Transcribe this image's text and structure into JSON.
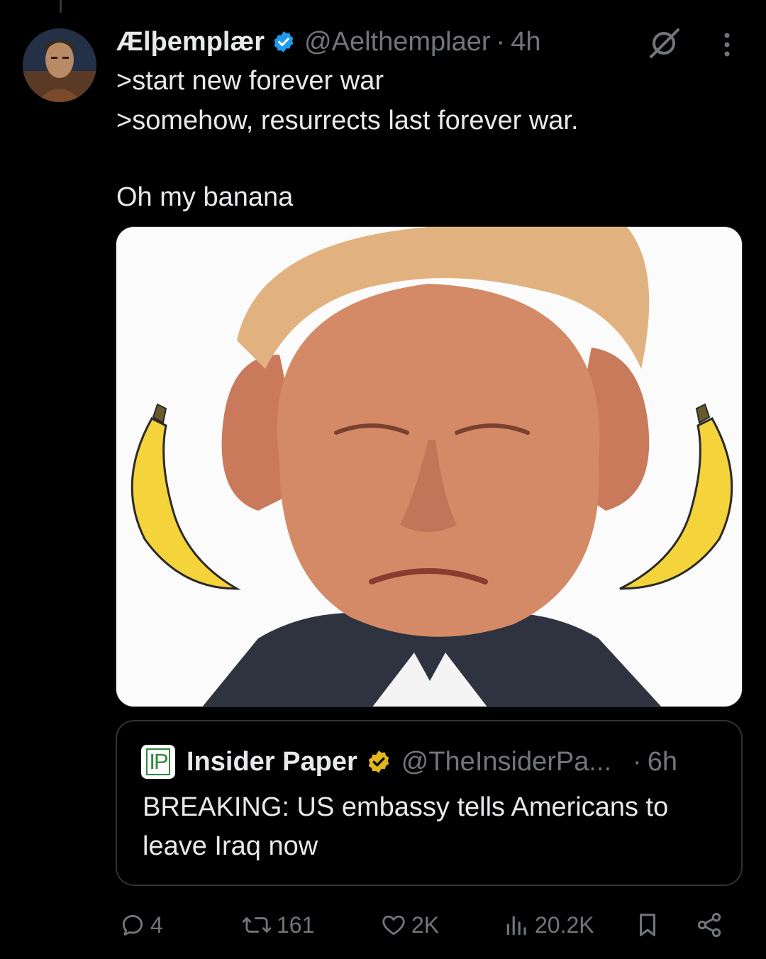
{
  "author": {
    "display_name": "Ælþemplær",
    "handle": "@Aelthemplaer",
    "separator": "·",
    "time": "4h",
    "verified_icon": "blue-check-icon"
  },
  "tweet": {
    "lines": [
      ">start new forever war",
      ">somehow, resurrects last forever war."
    ],
    "closing": "Oh my banana"
  },
  "media": {
    "subject": "photo-with-bananas"
  },
  "quote": {
    "logo": "IP",
    "display_name": "Insider Paper",
    "handle": "@TheInsiderPa...",
    "separator": "·",
    "time": "6h",
    "text": "BREAKING: US embassy tells Americans to leave Iraq now",
    "verified_icon": "gold-check-icon"
  },
  "actions": {
    "replies": "4",
    "reposts": "161",
    "likes": "2K",
    "views": "20.2K"
  },
  "colors": {
    "background": "#000000",
    "text": "#e7e9ea",
    "muted": "#71767b",
    "border": "#2f3336",
    "verified_blue": "#1d9bf0",
    "verified_gold": "#e2b719"
  }
}
